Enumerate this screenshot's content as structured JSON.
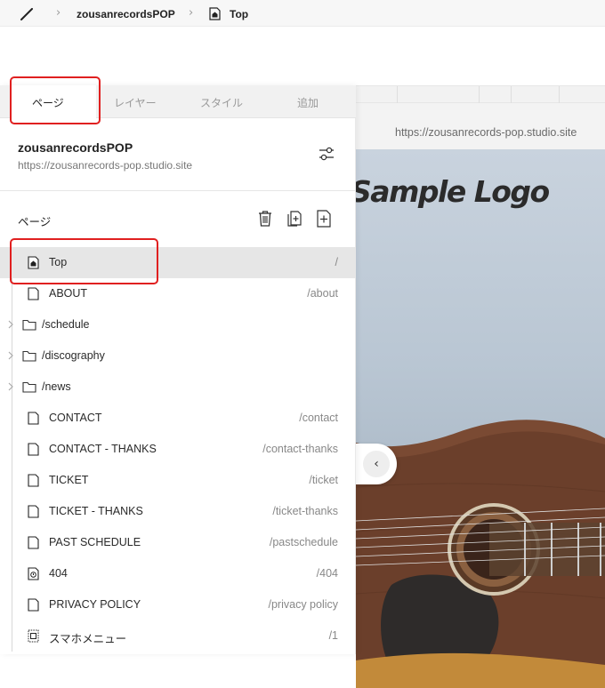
{
  "breadcrumb": {
    "project": "zousanrecordsPOP",
    "page": "Top"
  },
  "preview": {
    "url": "https://zousanrecords-pop.studio.site",
    "logo_text": "Sample Logo"
  },
  "panel": {
    "tabs": [
      {
        "label": "ページ",
        "active": true
      },
      {
        "label": "レイヤー",
        "active": false
      },
      {
        "label": "スタイル",
        "active": false
      },
      {
        "label": "追加",
        "active": false
      }
    ],
    "site_name": "zousanrecordsPOP",
    "site_url": "https://zousanrecords-pop.studio.site",
    "section_title": "ページ",
    "pages": [
      {
        "label": "Top",
        "path": "/",
        "type": "home",
        "selected": true
      },
      {
        "label": "ABOUT",
        "path": "/about",
        "type": "page"
      },
      {
        "label": "/schedule",
        "path": "",
        "type": "folder"
      },
      {
        "label": "/discography",
        "path": "",
        "type": "folder"
      },
      {
        "label": "/news",
        "path": "",
        "type": "folder"
      },
      {
        "label": "CONTACT",
        "path": "/contact",
        "type": "page"
      },
      {
        "label": "CONTACT - THANKS",
        "path": "/contact-thanks",
        "type": "page"
      },
      {
        "label": "TICKET",
        "path": "/ticket",
        "type": "page"
      },
      {
        "label": "TICKET - THANKS",
        "path": "/ticket-thanks",
        "type": "page"
      },
      {
        "label": "PAST SCHEDULE",
        "path": "/pastschedule",
        "type": "page"
      },
      {
        "label": "404",
        "path": "/404",
        "type": "error"
      },
      {
        "label": "PRIVACY POLICY",
        "path": "/privacy policy",
        "type": "page"
      },
      {
        "label": "スマホメニュー",
        "path": "/1",
        "type": "menu"
      }
    ]
  },
  "colors": {
    "highlight": "#e02020",
    "selected_row": "#e6e6e6"
  }
}
